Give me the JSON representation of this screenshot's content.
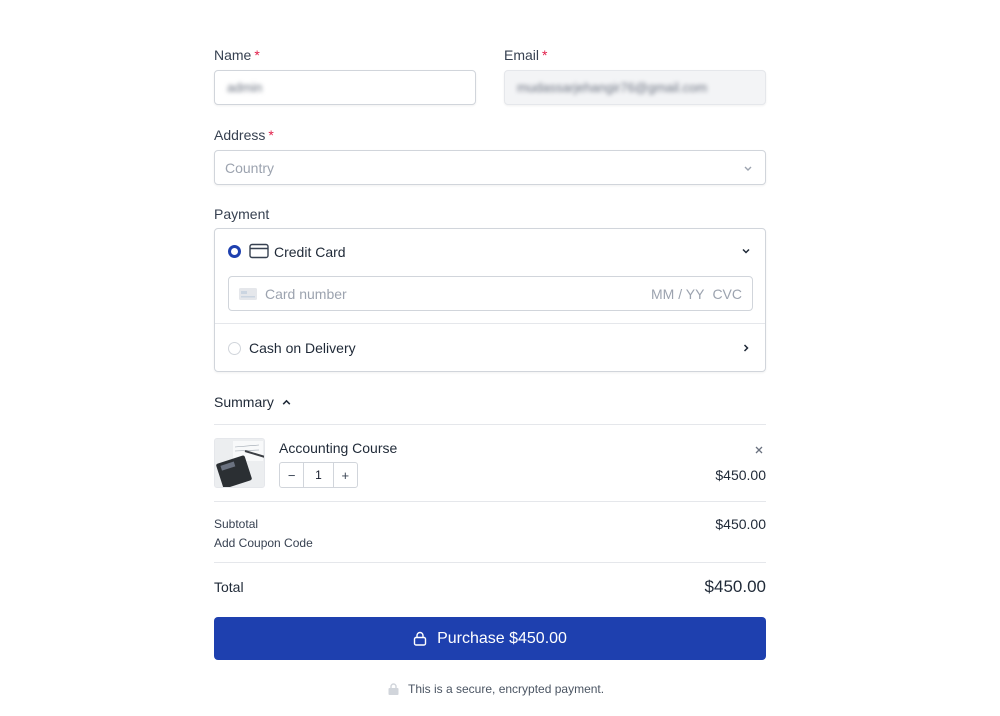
{
  "form": {
    "name": {
      "label": "Name",
      "required_mark": "*",
      "value": "admin"
    },
    "email": {
      "label": "Email",
      "required_mark": "*",
      "value": "mudassarjehangir76@gmail.com"
    },
    "address": {
      "label": "Address",
      "required_mark": "*",
      "placeholder": "Country"
    },
    "payment": {
      "label": "Payment",
      "credit_card": {
        "label": "Credit Card",
        "selected": true,
        "card_number_placeholder": "Card number",
        "expiry_placeholder": "MM / YY",
        "cvc_placeholder": "CVC"
      },
      "cash": {
        "label": "Cash on Delivery",
        "selected": false
      }
    }
  },
  "summary": {
    "label": "Summary",
    "item": {
      "name": "Accounting Course",
      "quantity": "1",
      "minus": "−",
      "plus": "+",
      "price": "$450.00"
    },
    "subtotal_label": "Subtotal",
    "subtotal_value": "$450.00",
    "coupon_label": "Add Coupon Code",
    "total_label": "Total",
    "total_value": "$450.00"
  },
  "purchase_button": {
    "label": "Purchase $450.00"
  },
  "secure_note": "This is a secure, encrypted payment.",
  "colors": {
    "accent": "#1e40af",
    "required": "#e11d48"
  }
}
